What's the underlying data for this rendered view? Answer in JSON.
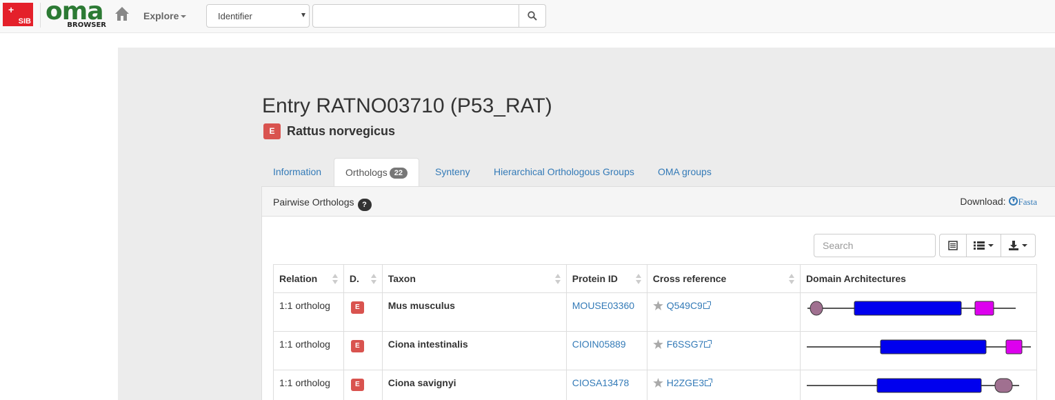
{
  "navbar": {
    "sib_text": "SIB",
    "oma_text": "oma",
    "browser_text": "BROWSER",
    "explore_label": "Explore",
    "select_value": "Identifier",
    "search_value": ""
  },
  "entry": {
    "title": "Entry RATNO03710 (P53_RAT)",
    "kingdom_badge": "E",
    "species": "Rattus norvegicus"
  },
  "tabs": [
    {
      "label": "Information"
    },
    {
      "label": "Orthologs",
      "badge": "22"
    },
    {
      "label": "Synteny"
    },
    {
      "label": "Hierarchical Orthologous Groups"
    },
    {
      "label": "OMA groups"
    }
  ],
  "panel": {
    "title": "Pairwise Orthologs",
    "help": "?",
    "download_label": "Download:",
    "fasta_label": "Fasta"
  },
  "toolbar": {
    "search_placeholder": "Search"
  },
  "table": {
    "headers": [
      "Relation",
      "D.",
      "Taxon",
      "Protein ID",
      "Cross reference",
      "Domain Architectures"
    ],
    "rows": [
      {
        "relation": "1:1 ortholog",
        "domain": "E",
        "taxon": "Mus musculus",
        "protein_id": "MOUSE03360",
        "xref": "Q549C9"
      },
      {
        "relation": "1:1 ortholog",
        "domain": "E",
        "taxon": "Ciona intestinalis",
        "protein_id": "CIOIN05889",
        "xref": "F6SSG7"
      },
      {
        "relation": "1:1 ortholog",
        "domain": "E",
        "taxon": "Ciona savignyi",
        "protein_id": "CIOSA13478",
        "xref": "H2ZGE3"
      }
    ]
  },
  "colors": {
    "domain_blue": "#0000ee",
    "domain_magenta": "#dd00ee",
    "domain_mauve": "#a07090",
    "badge_red": "#d9534f",
    "link_blue": "#337ab7"
  }
}
